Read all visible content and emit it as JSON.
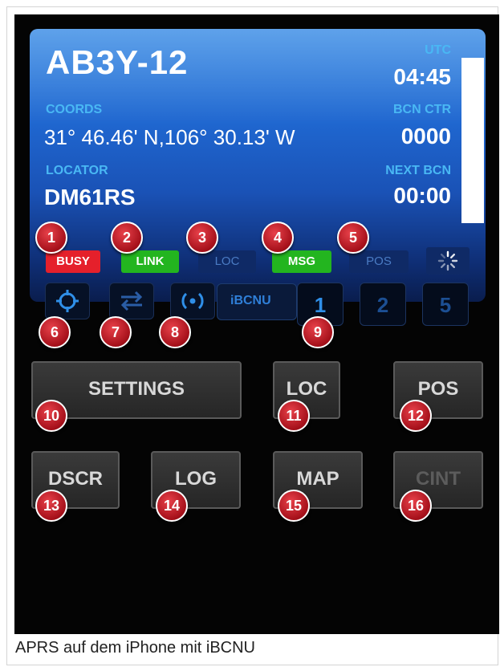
{
  "callsign": "AB3Y-12",
  "utc": {
    "label": "UTC",
    "value": "04:45"
  },
  "coords": {
    "label": "COORDS",
    "value": "31° 46.46' N,106° 30.13' W"
  },
  "bcn_ctr": {
    "label": "BCN CTR",
    "value": "0000"
  },
  "locator": {
    "label": "LOCATOR",
    "value": "DM61RS"
  },
  "next_bcn": {
    "label": "NEXT BCN",
    "value": "00:00"
  },
  "indicators": [
    {
      "label": "BUSY",
      "color": "#e5202b",
      "text_color": "#ffffff"
    },
    {
      "label": "LINK",
      "color": "#23b51f",
      "text_color": "#ffffff"
    },
    {
      "label": "LOC",
      "color": "#0f2a66",
      "text_color": "#4a7bc4"
    },
    {
      "label": "MSG",
      "color": "#23b51f",
      "text_color": "#ffffff"
    },
    {
      "label": "POS",
      "color": "#0f2a66",
      "text_color": "#4a7bc4"
    }
  ],
  "nav": {
    "brand": "iBCNU",
    "slots": [
      "1",
      "2",
      "5"
    ],
    "icons": [
      "crosshair-icon",
      "swap-arrows-icon",
      "beacon-signal-icon"
    ]
  },
  "buttons": {
    "settings": "SETTINGS",
    "loc": "LOC",
    "pos": "POS",
    "dscr": "DSCR",
    "log": "LOG",
    "map": "MAP",
    "cint": "CINT"
  },
  "badges": [
    "1",
    "2",
    "3",
    "4",
    "5",
    "6",
    "7",
    "8",
    "9",
    "10",
    "11",
    "12",
    "13",
    "14",
    "15",
    "16"
  ],
  "caption": "APRS auf dem iPhone mit iBCNU",
  "colors": {
    "accent_blue": "#1f66cf",
    "label_cyan": "#49b8f4",
    "badge_red": "#c0141f"
  }
}
